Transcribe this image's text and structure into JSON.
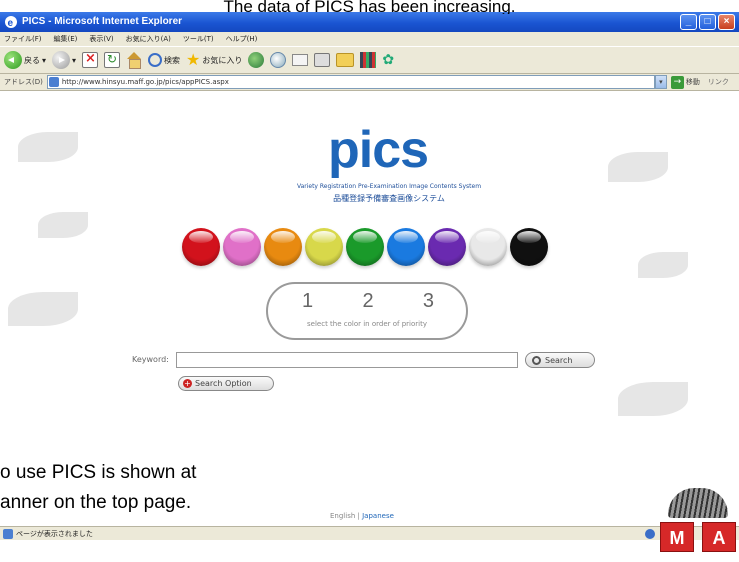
{
  "caption": {
    "top": "The data of PICS has been increasing.",
    "bottom_line1": "o use PICS is shown at",
    "bottom_line2": "anner on the top page."
  },
  "window": {
    "title": "PICS - Microsoft Internet Explorer",
    "controls": [
      "_",
      "□",
      "×"
    ]
  },
  "menubar": {
    "items": [
      "ファイル(F)",
      "編集(E)",
      "表示(V)",
      "お気に入り(A)",
      "ツール(T)",
      "ヘルプ(H)"
    ]
  },
  "toolbar": {
    "back_label": "戻る",
    "search_label": "検索",
    "favorites_label": "お気に入り"
  },
  "address": {
    "label": "アドレス(D)",
    "url": "http://www.hinsyu.maff.go.jp/pics/appPICS.aspx",
    "go_label": "移動",
    "links_label": "リンク"
  },
  "page": {
    "logo": "pics",
    "tagline": "Variety Registration Pre-Examination Image Contents System",
    "tagline_jp": "品種登録予備審査画像システム",
    "orb_colors": [
      {
        "name": "red",
        "hex": "#d2121c"
      },
      {
        "name": "pink",
        "hex": "#e070c8"
      },
      {
        "name": "orange",
        "hex": "#e88a10"
      },
      {
        "name": "yellow-green",
        "hex": "#d8d84a"
      },
      {
        "name": "green",
        "hex": "#1a9a2a"
      },
      {
        "name": "blue",
        "hex": "#1a7ae0"
      },
      {
        "name": "purple",
        "hex": "#6a2ab0"
      },
      {
        "name": "white",
        "hex": "#e8e8e8"
      },
      {
        "name": "black",
        "hex": "#101010"
      }
    ],
    "priority_numbers": [
      "1",
      "2",
      "3"
    ],
    "priority_hint": "select the color in order of priority",
    "keyword_label": "Keyword:",
    "keyword_value": "",
    "search_button": "Search",
    "search_option_button": "Search Option",
    "footer_english": "English",
    "footer_sep": "|",
    "footer_japanese": "Japanese"
  },
  "statusbar": {
    "text": "ページが表示されました"
  }
}
